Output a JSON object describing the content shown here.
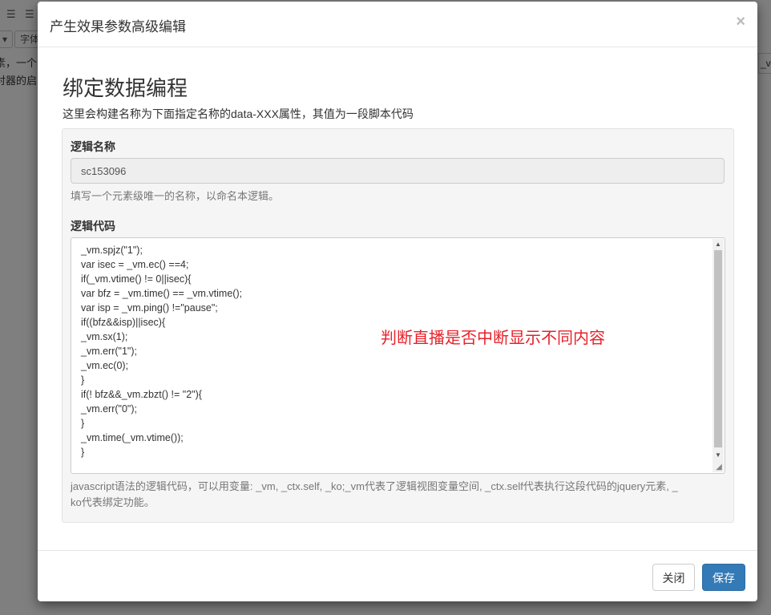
{
  "background": {
    "toolbar_btn_label": "字体",
    "line1": "素，一个",
    "line2": "对器的启",
    "right_box": "_vm"
  },
  "modal": {
    "title": "产生效果参数高级编辑",
    "close_glyph": "×",
    "section_title": "绑定数据编程",
    "section_desc": "这里会构建名称为下面指定名称的data-XXX属性，其值为一段脚本代码",
    "logic_name_label": "逻辑名称",
    "logic_name_value": "sc153096",
    "logic_name_help": "填写一个元素级唯一的名称，以命名本逻辑。",
    "logic_code_label": "逻辑代码",
    "code_lines": [
      "_vm.spjz(\"1\");",
      "var isec = _vm.ec() ==4;",
      "if(_vm.vtime() != 0||isec){",
      "var bfz = _vm.time() == _vm.vtime();",
      "var isp = _vm.ping() !=\"pause\";",
      "if((bfz&&isp)||isec){",
      "_vm.sx(1);",
      "_vm.err(\"1\");",
      "_vm.ec(0);",
      "}",
      "if(! bfz&&_vm.zbzt() != \"2\"){",
      "_vm.err(\"0\");",
      "}",
      "_vm.time(_vm.vtime());",
      "}"
    ],
    "annotation": "判断直播是否中断显示不同内容",
    "code_help_line1": "javascript语法的逻辑代码，可以用变量: _vm, _ctx.self, _ko;_vm代表了逻辑视图变量空间, _ctx.self代表执行这段代码的jquery元素, _",
    "code_help_line2": "ko代表绑定功能。",
    "close_button": "关闭",
    "save_button": "保存"
  },
  "colors": {
    "primary": "#337ab7",
    "annotation": "#e8212a"
  }
}
